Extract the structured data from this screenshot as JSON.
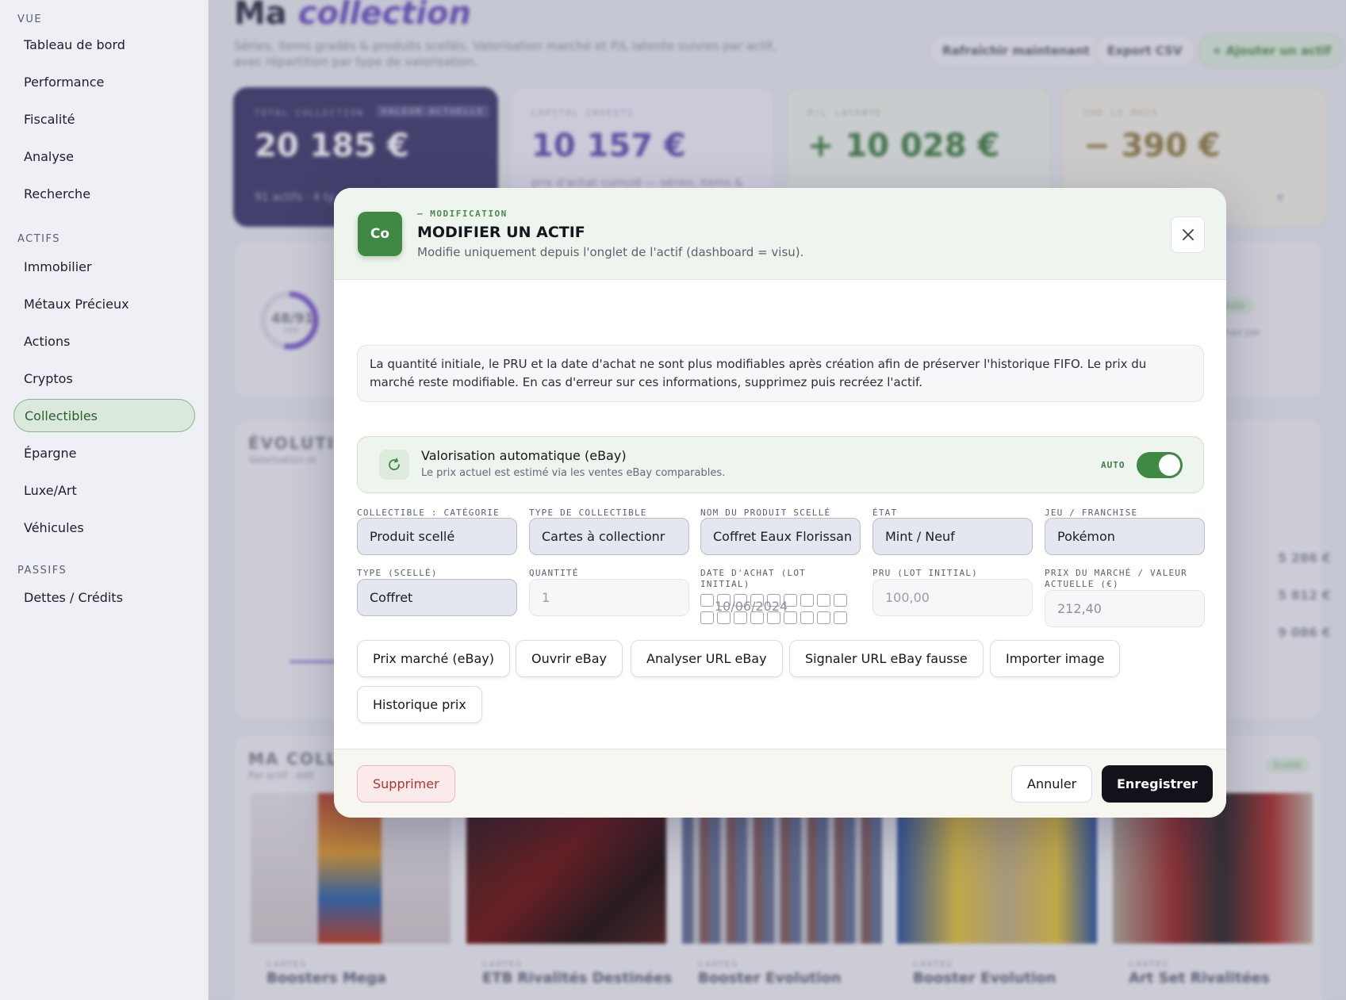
{
  "sidebar": {
    "sections": [
      "VUE",
      "ACTIFS",
      "PASSIFS"
    ],
    "vue_items": [
      "Tableau de bord",
      "Performance",
      "Fiscalité",
      "Analyse",
      "Recherche"
    ],
    "actifs_items": [
      "Immobilier",
      "Métaux Précieux",
      "Actions",
      "Cryptos",
      "Collectibles",
      "Épargne",
      "Luxe/Art",
      "Véhicules"
    ],
    "passifs_items": [
      "Dettes / Crédits"
    ],
    "active_item": "Collectibles"
  },
  "background": {
    "title_plain": "Ma",
    "title_accent": "collection",
    "subtitle": "Séries, items gradés & produits scellés. Valorisation marché et P/L latente suivies par actif, avec répartition par type de valorisation.",
    "buttons": [
      "Rafraîchir maintenant",
      "Export CSV",
      "+ Ajouter un actif"
    ],
    "cards": [
      {
        "label": "TOTAL COLLECTION",
        "tag": "VALEUR ACTUELLE",
        "value": "20 185 €",
        "note": "91 actifs · 4 ty"
      },
      {
        "label": "CAPITAL INVESTI",
        "value": "10 157 €",
        "note": "prix d'achat cumulé — séries, items &"
      },
      {
        "label": "P/L LATENTE",
        "value": "+ 10 028 €",
        "note": ""
      },
      {
        "label": "SUR LE MOIS",
        "value": "− 390 €",
        "note": "e"
      }
    ],
    "ring_label": "48/91",
    "ring_sub": "cote",
    "chip_auto": "rs auto",
    "chip_note": "7 j max par",
    "evolution_title": "ÉVOLUTIO",
    "evolution_sub": "Valorisation m",
    "side_values": [
      "5 286 €",
      "5 812 €",
      "9 086 €"
    ],
    "collection_title": "MA COLLE",
    "collection_sub": "Par actif · édit",
    "collection_chip": "Scellé",
    "items": [
      {
        "meta": "CARTES",
        "name": "Boosters Mega"
      },
      {
        "meta": "CARTES",
        "name": "ETB Rivalités Destinées"
      },
      {
        "meta": "CARTES",
        "name": "Booster Evolution"
      },
      {
        "meta": "CARTES",
        "name": "Booster Evolution"
      },
      {
        "meta": "CARTES",
        "name": "Art Set Rivalitées"
      }
    ]
  },
  "modal": {
    "badge": "Co",
    "kicker": "— MODIFICATION",
    "title": "MODIFIER UN ACTIF",
    "description": "Modifie uniquement depuis l'onglet de l'actif (dashboard = visu).",
    "info": "La quantité initiale, le PRU et la date d'achat ne sont plus modifiables après création afin de préserver l'historique FIFO. Le prix du marché reste modifiable. En cas d'erreur sur ces informations, supprimez puis recréez l'actif.",
    "auto_valuation": {
      "title": "Valorisation automatique (eBay)",
      "subtitle": "Le prix actuel est estimé via les ventes eBay comparables.",
      "tag": "AUTO",
      "enabled": true
    },
    "fields": {
      "categorie": {
        "label": "COLLECTIBLE : CATÉGORIE",
        "value": "Produit scellé"
      },
      "type_collectible": {
        "label": "TYPE DE COLLECTIBLE",
        "value": "Cartes à collectionr"
      },
      "nom_produit": {
        "label": "NOM DU PRODUIT SCELLÉ",
        "value": "Coffret Eaux Florissan"
      },
      "etat": {
        "label": "ÉTAT",
        "value": "Mint / Neuf"
      },
      "jeu": {
        "label": "JEU / FRANCHISE",
        "value": "Pokémon"
      },
      "type_scelle": {
        "label": "TYPE (SCELLÉ)",
        "value": "Coffret"
      },
      "quantite": {
        "label": "QUANTITÉ",
        "value": "1"
      },
      "date_achat": {
        "label_1": "DATE D'ACHAT (LOT",
        "label_2": "INITIAL)",
        "value": "10/06/2024"
      },
      "pru": {
        "label": "PRU (LOT INITIAL)",
        "value": "100,00"
      },
      "prix_marche": {
        "label_1": "PRIX DU MARCHÉ / VALEUR",
        "label_2": "ACTUELLE (€)",
        "value": "212,40"
      }
    },
    "actions": [
      "Prix marché (eBay)",
      "Ouvrir eBay",
      "Analyser URL eBay",
      "Signaler URL eBay fausse",
      "Importer image",
      "Historique prix"
    ],
    "footer": {
      "delete": "Supprimer",
      "cancel": "Annuler",
      "save": "Enregistrer"
    }
  },
  "colors": {
    "accent_green": "#3f8a43",
    "accent_purple": "#7a5fc8",
    "danger": "#b3342f",
    "primary_dark": "#12131a"
  }
}
